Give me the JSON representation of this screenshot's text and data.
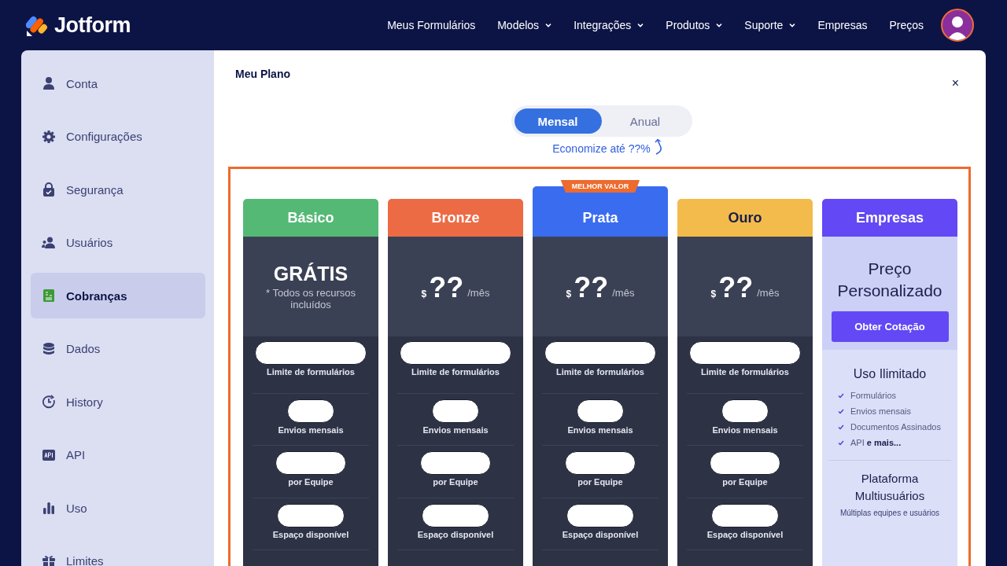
{
  "header": {
    "logo": "Jotform",
    "nav": [
      {
        "label": "Meus Formulários",
        "has_menu": false
      },
      {
        "label": "Modelos",
        "has_menu": true
      },
      {
        "label": "Integrações",
        "has_menu": true
      },
      {
        "label": "Produtos",
        "has_menu": true
      },
      {
        "label": "Suporte",
        "has_menu": true
      },
      {
        "label": "Empresas",
        "has_menu": false
      },
      {
        "label": "Preços",
        "has_menu": false
      }
    ]
  },
  "sidebar": {
    "items": [
      {
        "label": "Conta",
        "selected": false
      },
      {
        "label": "Configurações",
        "selected": false
      },
      {
        "label": "Segurança",
        "selected": false
      },
      {
        "label": "Usuários",
        "selected": false
      },
      {
        "label": "Cobranças",
        "selected": true
      },
      {
        "label": "Dados",
        "selected": false
      },
      {
        "label": "History",
        "selected": false
      },
      {
        "label": "API",
        "selected": false
      },
      {
        "label": "Uso",
        "selected": false
      },
      {
        "label": "Limites",
        "selected": false
      }
    ]
  },
  "dialog": {
    "title": "Meu Plano",
    "close": "×",
    "billing_toggle": [
      {
        "label": "Mensal",
        "selected": true
      },
      {
        "label": "Anual",
        "selected": false
      }
    ],
    "savings_note": "Economize até ??%",
    "plans": [
      {
        "kind": "free",
        "name": "Básico",
        "color": "#55b976",
        "price": "GRÁTIS",
        "price_note": "* Todos os recursos incluídos",
        "features": [
          "Limite de formulários",
          "Envios mensais",
          "por Equipe",
          "Espaço disponível"
        ]
      },
      {
        "kind": "paid",
        "name": "Bronze",
        "color": "#ec6b45",
        "currency": "$",
        "amount": "??",
        "period": "/mês",
        "features": [
          "Limite de formulários",
          "Envios mensais",
          "por Equipe",
          "Espaço disponível"
        ]
      },
      {
        "kind": "paid",
        "name": "Prata",
        "color": "#3a6cf0",
        "badge": "MELHOR VALOR",
        "currency": "$",
        "amount": "??",
        "period": "/mês",
        "features": [
          "Limite de formulários",
          "Envios mensais",
          "por Equipe",
          "Espaço disponível"
        ]
      },
      {
        "kind": "paid",
        "name": "Ouro",
        "color": "#f3bb4b",
        "currency": "$",
        "amount": "??",
        "period": "/mês",
        "features": [
          "Limite de formulários",
          "Envios mensais",
          "por Equipe",
          "Espaço disponível"
        ]
      },
      {
        "kind": "enterprise",
        "name": "Empresas",
        "color": "#6348f5",
        "price": "Preço Personalizado",
        "button": "Obter Cotação",
        "section_title": "Uso Ilimitado",
        "checklist": [
          "Formulários",
          "Envios mensais",
          "Documentos Assinados",
          "API **e mais...**"
        ],
        "section2_title": "Plataforma Multiusuários",
        "section2_note": "Múltiplas equipes e usuários"
      }
    ]
  }
}
